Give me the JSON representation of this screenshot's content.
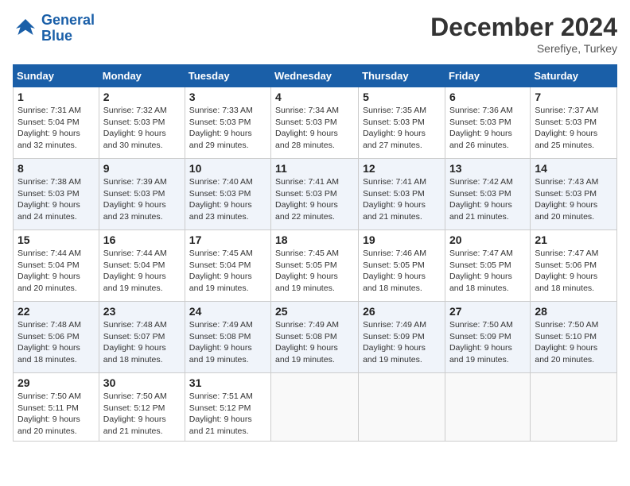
{
  "header": {
    "logo_line1": "General",
    "logo_line2": "Blue",
    "month": "December 2024",
    "location": "Serefiye, Turkey"
  },
  "days_of_week": [
    "Sunday",
    "Monday",
    "Tuesday",
    "Wednesday",
    "Thursday",
    "Friday",
    "Saturday"
  ],
  "weeks": [
    [
      {
        "day": "1",
        "info": "Sunrise: 7:31 AM\nSunset: 5:04 PM\nDaylight: 9 hours\nand 32 minutes."
      },
      {
        "day": "2",
        "info": "Sunrise: 7:32 AM\nSunset: 5:03 PM\nDaylight: 9 hours\nand 30 minutes."
      },
      {
        "day": "3",
        "info": "Sunrise: 7:33 AM\nSunset: 5:03 PM\nDaylight: 9 hours\nand 29 minutes."
      },
      {
        "day": "4",
        "info": "Sunrise: 7:34 AM\nSunset: 5:03 PM\nDaylight: 9 hours\nand 28 minutes."
      },
      {
        "day": "5",
        "info": "Sunrise: 7:35 AM\nSunset: 5:03 PM\nDaylight: 9 hours\nand 27 minutes."
      },
      {
        "day": "6",
        "info": "Sunrise: 7:36 AM\nSunset: 5:03 PM\nDaylight: 9 hours\nand 26 minutes."
      },
      {
        "day": "7",
        "info": "Sunrise: 7:37 AM\nSunset: 5:03 PM\nDaylight: 9 hours\nand 25 minutes."
      }
    ],
    [
      {
        "day": "8",
        "info": "Sunrise: 7:38 AM\nSunset: 5:03 PM\nDaylight: 9 hours\nand 24 minutes."
      },
      {
        "day": "9",
        "info": "Sunrise: 7:39 AM\nSunset: 5:03 PM\nDaylight: 9 hours\nand 23 minutes."
      },
      {
        "day": "10",
        "info": "Sunrise: 7:40 AM\nSunset: 5:03 PM\nDaylight: 9 hours\nand 23 minutes."
      },
      {
        "day": "11",
        "info": "Sunrise: 7:41 AM\nSunset: 5:03 PM\nDaylight: 9 hours\nand 22 minutes."
      },
      {
        "day": "12",
        "info": "Sunrise: 7:41 AM\nSunset: 5:03 PM\nDaylight: 9 hours\nand 21 minutes."
      },
      {
        "day": "13",
        "info": "Sunrise: 7:42 AM\nSunset: 5:03 PM\nDaylight: 9 hours\nand 21 minutes."
      },
      {
        "day": "14",
        "info": "Sunrise: 7:43 AM\nSunset: 5:03 PM\nDaylight: 9 hours\nand 20 minutes."
      }
    ],
    [
      {
        "day": "15",
        "info": "Sunrise: 7:44 AM\nSunset: 5:04 PM\nDaylight: 9 hours\nand 20 minutes."
      },
      {
        "day": "16",
        "info": "Sunrise: 7:44 AM\nSunset: 5:04 PM\nDaylight: 9 hours\nand 19 minutes."
      },
      {
        "day": "17",
        "info": "Sunrise: 7:45 AM\nSunset: 5:04 PM\nDaylight: 9 hours\nand 19 minutes."
      },
      {
        "day": "18",
        "info": "Sunrise: 7:45 AM\nSunset: 5:05 PM\nDaylight: 9 hours\nand 19 minutes."
      },
      {
        "day": "19",
        "info": "Sunrise: 7:46 AM\nSunset: 5:05 PM\nDaylight: 9 hours\nand 18 minutes."
      },
      {
        "day": "20",
        "info": "Sunrise: 7:47 AM\nSunset: 5:05 PM\nDaylight: 9 hours\nand 18 minutes."
      },
      {
        "day": "21",
        "info": "Sunrise: 7:47 AM\nSunset: 5:06 PM\nDaylight: 9 hours\nand 18 minutes."
      }
    ],
    [
      {
        "day": "22",
        "info": "Sunrise: 7:48 AM\nSunset: 5:06 PM\nDaylight: 9 hours\nand 18 minutes."
      },
      {
        "day": "23",
        "info": "Sunrise: 7:48 AM\nSunset: 5:07 PM\nDaylight: 9 hours\nand 18 minutes."
      },
      {
        "day": "24",
        "info": "Sunrise: 7:49 AM\nSunset: 5:08 PM\nDaylight: 9 hours\nand 19 minutes."
      },
      {
        "day": "25",
        "info": "Sunrise: 7:49 AM\nSunset: 5:08 PM\nDaylight: 9 hours\nand 19 minutes."
      },
      {
        "day": "26",
        "info": "Sunrise: 7:49 AM\nSunset: 5:09 PM\nDaylight: 9 hours\nand 19 minutes."
      },
      {
        "day": "27",
        "info": "Sunrise: 7:50 AM\nSunset: 5:09 PM\nDaylight: 9 hours\nand 19 minutes."
      },
      {
        "day": "28",
        "info": "Sunrise: 7:50 AM\nSunset: 5:10 PM\nDaylight: 9 hours\nand 20 minutes."
      }
    ],
    [
      {
        "day": "29",
        "info": "Sunrise: 7:50 AM\nSunset: 5:11 PM\nDaylight: 9 hours\nand 20 minutes."
      },
      {
        "day": "30",
        "info": "Sunrise: 7:50 AM\nSunset: 5:12 PM\nDaylight: 9 hours\nand 21 minutes."
      },
      {
        "day": "31",
        "info": "Sunrise: 7:51 AM\nSunset: 5:12 PM\nDaylight: 9 hours\nand 21 minutes."
      },
      {
        "day": "",
        "info": ""
      },
      {
        "day": "",
        "info": ""
      },
      {
        "day": "",
        "info": ""
      },
      {
        "day": "",
        "info": ""
      }
    ]
  ]
}
